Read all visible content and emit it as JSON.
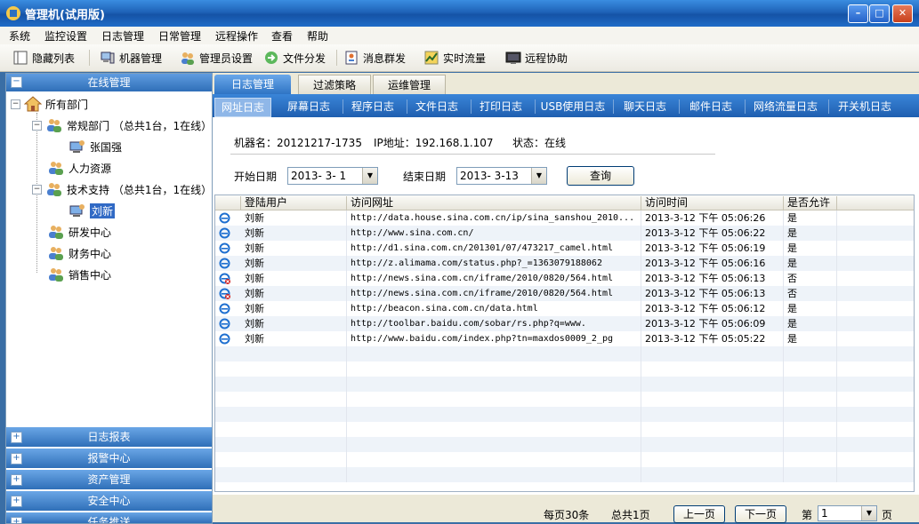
{
  "window": {
    "title": "管理机(试用版)",
    "controls": [
      "minimize-icon",
      "maximize-icon",
      "close-icon"
    ]
  },
  "menu": [
    "系统",
    "监控设置",
    "日志管理",
    "日常管理",
    "远程操作",
    "查看",
    "帮助"
  ],
  "toolbar": {
    "hide_list": "隐藏列表",
    "machine_mgmt": "机器管理",
    "admin_settings": "管理员设置",
    "file_dist": "文件分发",
    "msg_broadcast": "消息群发",
    "realtime_traffic": "实时流量",
    "remote_assist": "远程协助"
  },
  "left": {
    "panel_title": "在线管理",
    "tree": {
      "root": "所有部门",
      "dept1": "常规部门 （总共1台，1在线）",
      "dept1_user": "张国强",
      "dept2": "人力资源",
      "dept3": "技术支持 （总共1台，1在线）",
      "dept3_user": "刘新",
      "dept4": "研发中心",
      "dept5": "财务中心",
      "dept6": "销售中心"
    },
    "bottom_panels": [
      "日志报表",
      "报警中心",
      "资产管理",
      "安全中心",
      "任务推送"
    ]
  },
  "tabs_top": [
    "日志管理",
    "过滤策略",
    "运维管理"
  ],
  "tabs_log": [
    "网址日志",
    "屏幕日志",
    "程序日志",
    "文件日志",
    "打印日志",
    "USB使用日志",
    "聊天日志",
    "邮件日志",
    "网络流量日志",
    "开关机日志"
  ],
  "info": {
    "machine": "机器名：20121217-1735",
    "ip": "IP地址：192.168.1.107",
    "status": "状态：在线"
  },
  "filter": {
    "start_label": "开始日期",
    "start_value": "2013- 3- 1",
    "end_label": "结束日期",
    "end_value": "2013- 3-13",
    "query": "查询"
  },
  "grid": {
    "headers": [
      "登陆用户",
      "访问网址",
      "访问时间",
      "是否允许"
    ],
    "rows": [
      {
        "user": "刘新",
        "url": "http://data.house.sina.com.cn/ip/sina_sanshou_2010...",
        "time": "2013-3-12 下午 05:06:26",
        "allowed": "是",
        "blocked": false
      },
      {
        "user": "刘新",
        "url": "http://www.sina.com.cn/",
        "time": "2013-3-12 下午 05:06:22",
        "allowed": "是",
        "blocked": false
      },
      {
        "user": "刘新",
        "url": "http://d1.sina.com.cn/201301/07/473217_camel.html",
        "time": "2013-3-12 下午 05:06:19",
        "allowed": "是",
        "blocked": false
      },
      {
        "user": "刘新",
        "url": "http://z.alimama.com/status.php?_=1363079188062",
        "time": "2013-3-12 下午 05:06:16",
        "allowed": "是",
        "blocked": false
      },
      {
        "user": "刘新",
        "url": "http://news.sina.com.cn/iframe/2010/0820/564.html",
        "time": "2013-3-12 下午 05:06:13",
        "allowed": "否",
        "blocked": true
      },
      {
        "user": "刘新",
        "url": "http://news.sina.com.cn/iframe/2010/0820/564.html",
        "time": "2013-3-12 下午 05:06:13",
        "allowed": "否",
        "blocked": true
      },
      {
        "user": "刘新",
        "url": "http://beacon.sina.com.cn/data.html",
        "time": "2013-3-12 下午 05:06:12",
        "allowed": "是",
        "blocked": false
      },
      {
        "user": "刘新",
        "url": "http://toolbar.baidu.com/sobar/rs.php?q=www.",
        "time": "2013-3-12 下午 05:06:09",
        "allowed": "是",
        "blocked": false
      },
      {
        "user": "刘新",
        "url": "http://www.baidu.com/index.php?tn=maxdos0009_2_pg",
        "time": "2013-3-12 下午 05:05:22",
        "allowed": "是",
        "blocked": false
      }
    ]
  },
  "footer": {
    "per_page": "每页30条",
    "total_pages": "总共1页",
    "prev": "上一页",
    "next": "下一页",
    "page_label": "第",
    "page_value": "1",
    "page_unit": "页"
  },
  "colors": {
    "accent": "#2f6fb8",
    "row_alt": "#eef3f9",
    "titlebar": "#1f63b8"
  }
}
